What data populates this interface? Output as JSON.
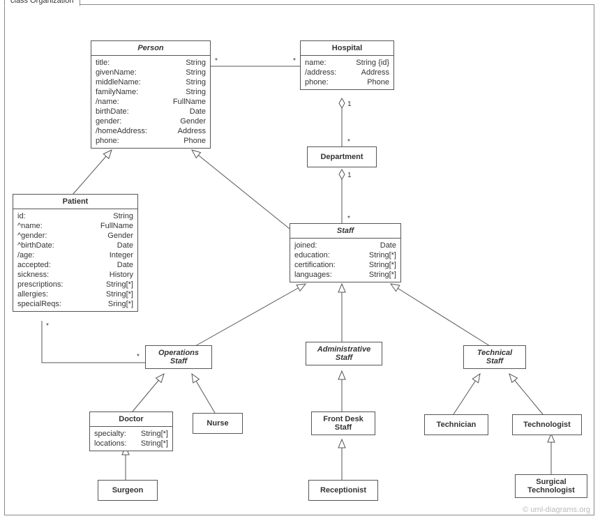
{
  "frame": {
    "title": "class Organization"
  },
  "watermark": "© uml-diagrams.org",
  "classes": {
    "person": {
      "title": "Person",
      "attrs": [
        [
          "title:",
          "String"
        ],
        [
          "givenName:",
          "String"
        ],
        [
          "middleName:",
          "String"
        ],
        [
          "familyName:",
          "String"
        ],
        [
          "/name:",
          "FullName"
        ],
        [
          "birthDate:",
          "Date"
        ],
        [
          "gender:",
          "Gender"
        ],
        [
          "/homeAddress:",
          "Address"
        ],
        [
          "phone:",
          "Phone"
        ]
      ]
    },
    "hospital": {
      "title": "Hospital",
      "attrs": [
        [
          "name:",
          "String {id}"
        ],
        [
          "/address:",
          "Address"
        ],
        [
          "phone:",
          "Phone"
        ]
      ]
    },
    "department": {
      "title": "Department"
    },
    "patient": {
      "title": "Patient",
      "attrs": [
        [
          "id:",
          "String"
        ],
        [
          "^name:",
          "FullName"
        ],
        [
          "^gender:",
          "Gender"
        ],
        [
          "^birthDate:",
          "Date"
        ],
        [
          "/age:",
          "Integer"
        ],
        [
          "accepted:",
          "Date"
        ],
        [
          "sickness:",
          "History"
        ],
        [
          "prescriptions:",
          "String[*]"
        ],
        [
          "allergies:",
          "String[*]"
        ],
        [
          "specialReqs:",
          "Sring[*]"
        ]
      ]
    },
    "staff": {
      "title": "Staff",
      "attrs": [
        [
          "joined:",
          "Date"
        ],
        [
          "education:",
          "String[*]"
        ],
        [
          "certification:",
          "String[*]"
        ],
        [
          "languages:",
          "String[*]"
        ]
      ]
    },
    "opsStaff": {
      "title": "Operations\nStaff"
    },
    "adminStaff": {
      "title": "Administrative\nStaff"
    },
    "techStaff": {
      "title": "Technical\nStaff"
    },
    "doctor": {
      "title": "Doctor",
      "attrs": [
        [
          "specialty:",
          "String[*]"
        ],
        [
          "locations:",
          "String[*]"
        ]
      ]
    },
    "nurse": {
      "title": "Nurse"
    },
    "frontDesk": {
      "title": "Front Desk\nStaff"
    },
    "receptionist": {
      "title": "Receptionist"
    },
    "technician": {
      "title": "Technician"
    },
    "technologist": {
      "title": "Technologist"
    },
    "surgeon": {
      "title": "Surgeon"
    },
    "surgTech": {
      "title": "Surgical\nTechnologist"
    }
  },
  "mult": {
    "personHospL": "*",
    "personHospR": "*",
    "hospDeptTop": "1",
    "hospDeptBot": "*",
    "deptStaffTop": "1",
    "deptStaffBot": "*",
    "patientOpsL": "*",
    "patientOpsR": "*"
  }
}
